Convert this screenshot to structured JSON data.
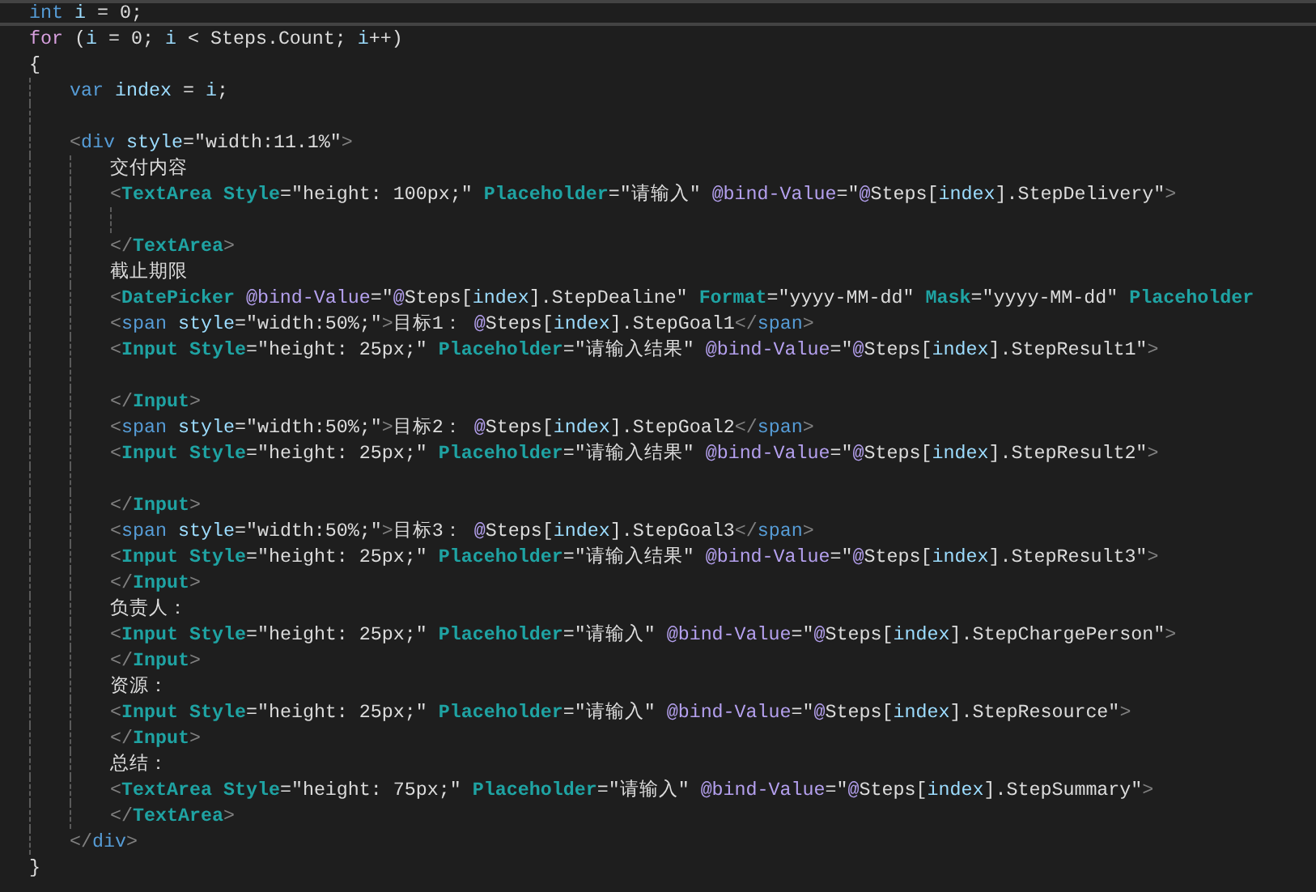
{
  "sticky_line": {
    "kind": "code",
    "tokens": [
      {
        "text": "int",
        "kind": "kw"
      },
      {
        "text": " i",
        "kind": "var"
      },
      {
        "text": " = 0;",
        "kind": "p"
      }
    ]
  },
  "lines": [
    {
      "kind": "code",
      "tokens": [
        {
          "text": "for",
          "kind": "ctl"
        },
        {
          "text": " (",
          "kind": "p"
        },
        {
          "text": "i",
          "kind": "var"
        },
        {
          "text": " = 0; ",
          "kind": "p"
        },
        {
          "text": "i",
          "kind": "var"
        },
        {
          "text": " < Steps.Count; ",
          "kind": "p"
        },
        {
          "text": "i",
          "kind": "var"
        },
        {
          "text": "++)",
          "kind": "p"
        }
      ]
    },
    {
      "kind": "code",
      "tokens": [
        {
          "text": "{",
          "kind": "p"
        }
      ],
      "children": [
        {
          "kind": "code",
          "tokens": [
            {
              "text": "var",
              "kind": "kw"
            },
            {
              "text": " index",
              "kind": "var"
            },
            {
              "text": " = ",
              "kind": "p"
            },
            {
              "text": "i",
              "kind": "var"
            },
            {
              "text": ";",
              "kind": "p"
            }
          ]
        },
        {
          "kind": "blank"
        },
        {
          "kind": "code",
          "tokens": [
            {
              "text": "<",
              "kind": "br"
            },
            {
              "text": "div",
              "kind": "tag"
            },
            {
              "text": " style",
              "kind": "attr"
            },
            {
              "text": "=\"width:11.1%\"",
              "kind": "p"
            },
            {
              "text": ">",
              "kind": "br"
            }
          ],
          "children": [
            {
              "kind": "code",
              "tokens": [
                {
                  "text": "交付内容",
                  "kind": "p"
                }
              ]
            },
            {
              "kind": "code",
              "tokens": [
                {
                  "text": "<",
                  "kind": "br"
                },
                {
                  "text": "TextArea",
                  "kind": "comp"
                },
                {
                  "text": " Style",
                  "kind": "comp"
                },
                {
                  "text": "=\"height: 100px;\" ",
                  "kind": "p"
                },
                {
                  "text": "Placeholder",
                  "kind": "comp"
                },
                {
                  "text": "=\"请输入\" ",
                  "kind": "p"
                },
                {
                  "text": "@bind-Value",
                  "kind": "dir"
                },
                {
                  "text": "=\"",
                  "kind": "p"
                },
                {
                  "text": "@",
                  "kind": "at"
                },
                {
                  "text": "Steps[",
                  "kind": "p"
                },
                {
                  "text": "index",
                  "kind": "var"
                },
                {
                  "text": "].StepDelivery\"",
                  "kind": "p"
                },
                {
                  "text": ">",
                  "kind": "br"
                }
              ],
              "children": [
                {
                  "kind": "blank"
                }
              ]
            },
            {
              "kind": "code",
              "tokens": [
                {
                  "text": "</",
                  "kind": "br"
                },
                {
                  "text": "TextArea",
                  "kind": "comp"
                },
                {
                  "text": ">",
                  "kind": "br"
                }
              ]
            },
            {
              "kind": "code",
              "tokens": [
                {
                  "text": "截止期限",
                  "kind": "p"
                }
              ]
            },
            {
              "kind": "code",
              "tokens": [
                {
                  "text": "<",
                  "kind": "br"
                },
                {
                  "text": "DatePicker",
                  "kind": "comp"
                },
                {
                  "text": " @bind-Value",
                  "kind": "dir"
                },
                {
                  "text": "=\"",
                  "kind": "p"
                },
                {
                  "text": "@",
                  "kind": "at"
                },
                {
                  "text": "Steps[",
                  "kind": "p"
                },
                {
                  "text": "index",
                  "kind": "var"
                },
                {
                  "text": "].StepDealine\" ",
                  "kind": "p"
                },
                {
                  "text": "Format",
                  "kind": "comp"
                },
                {
                  "text": "=\"yyyy-MM-dd\" ",
                  "kind": "p"
                },
                {
                  "text": "Mask",
                  "kind": "comp"
                },
                {
                  "text": "=\"yyyy-MM-dd\" ",
                  "kind": "p"
                },
                {
                  "text": "Placeholder",
                  "kind": "comp"
                }
              ]
            },
            {
              "kind": "code",
              "tokens": [
                {
                  "text": "<",
                  "kind": "br"
                },
                {
                  "text": "span",
                  "kind": "tag"
                },
                {
                  "text": " style",
                  "kind": "attr"
                },
                {
                  "text": "=\"width:50%;\"",
                  "kind": "p"
                },
                {
                  "text": ">",
                  "kind": "br"
                },
                {
                  "text": "目标1： ",
                  "kind": "p"
                },
                {
                  "text": "@",
                  "kind": "at"
                },
                {
                  "text": "Steps[",
                  "kind": "p"
                },
                {
                  "text": "index",
                  "kind": "var"
                },
                {
                  "text": "].StepGoal1",
                  "kind": "p"
                },
                {
                  "text": "</",
                  "kind": "br"
                },
                {
                  "text": "span",
                  "kind": "tag"
                },
                {
                  "text": ">",
                  "kind": "br"
                }
              ]
            },
            {
              "kind": "code",
              "tokens": [
                {
                  "text": "<",
                  "kind": "br"
                },
                {
                  "text": "Input",
                  "kind": "comp"
                },
                {
                  "text": " Style",
                  "kind": "comp"
                },
                {
                  "text": "=\"height: 25px;\" ",
                  "kind": "p"
                },
                {
                  "text": "Placeholder",
                  "kind": "comp"
                },
                {
                  "text": "=\"请输入结果\" ",
                  "kind": "p"
                },
                {
                  "text": "@bind-Value",
                  "kind": "dir"
                },
                {
                  "text": "=\"",
                  "kind": "p"
                },
                {
                  "text": "@",
                  "kind": "at"
                },
                {
                  "text": "Steps[",
                  "kind": "p"
                },
                {
                  "text": "index",
                  "kind": "var"
                },
                {
                  "text": "].StepResult1\"",
                  "kind": "p"
                },
                {
                  "text": ">",
                  "kind": "br"
                }
              ]
            },
            {
              "kind": "blank"
            },
            {
              "kind": "code",
              "tokens": [
                {
                  "text": "</",
                  "kind": "br"
                },
                {
                  "text": "Input",
                  "kind": "comp"
                },
                {
                  "text": ">",
                  "kind": "br"
                }
              ]
            },
            {
              "kind": "code",
              "tokens": [
                {
                  "text": "<",
                  "kind": "br"
                },
                {
                  "text": "span",
                  "kind": "tag"
                },
                {
                  "text": " style",
                  "kind": "attr"
                },
                {
                  "text": "=\"width:50%;\"",
                  "kind": "p"
                },
                {
                  "text": ">",
                  "kind": "br"
                },
                {
                  "text": "目标2： ",
                  "kind": "p"
                },
                {
                  "text": "@",
                  "kind": "at"
                },
                {
                  "text": "Steps[",
                  "kind": "p"
                },
                {
                  "text": "index",
                  "kind": "var"
                },
                {
                  "text": "].StepGoal2",
                  "kind": "p"
                },
                {
                  "text": "</",
                  "kind": "br"
                },
                {
                  "text": "span",
                  "kind": "tag"
                },
                {
                  "text": ">",
                  "kind": "br"
                }
              ]
            },
            {
              "kind": "code",
              "tokens": [
                {
                  "text": "<",
                  "kind": "br"
                },
                {
                  "text": "Input",
                  "kind": "comp"
                },
                {
                  "text": " Style",
                  "kind": "comp"
                },
                {
                  "text": "=\"height: 25px;\" ",
                  "kind": "p"
                },
                {
                  "text": "Placeholder",
                  "kind": "comp"
                },
                {
                  "text": "=\"请输入结果\" ",
                  "kind": "p"
                },
                {
                  "text": "@bind-Value",
                  "kind": "dir"
                },
                {
                  "text": "=\"",
                  "kind": "p"
                },
                {
                  "text": "@",
                  "kind": "at"
                },
                {
                  "text": "Steps[",
                  "kind": "p"
                },
                {
                  "text": "index",
                  "kind": "var"
                },
                {
                  "text": "].StepResult2\"",
                  "kind": "p"
                },
                {
                  "text": ">",
                  "kind": "br"
                }
              ]
            },
            {
              "kind": "blank"
            },
            {
              "kind": "code",
              "tokens": [
                {
                  "text": "</",
                  "kind": "br"
                },
                {
                  "text": "Input",
                  "kind": "comp"
                },
                {
                  "text": ">",
                  "kind": "br"
                }
              ]
            },
            {
              "kind": "code",
              "tokens": [
                {
                  "text": "<",
                  "kind": "br"
                },
                {
                  "text": "span",
                  "kind": "tag"
                },
                {
                  "text": " style",
                  "kind": "attr"
                },
                {
                  "text": "=\"width:50%;\"",
                  "kind": "p"
                },
                {
                  "text": ">",
                  "kind": "br"
                },
                {
                  "text": "目标3： ",
                  "kind": "p"
                },
                {
                  "text": "@",
                  "kind": "at"
                },
                {
                  "text": "Steps[",
                  "kind": "p"
                },
                {
                  "text": "index",
                  "kind": "var"
                },
                {
                  "text": "].StepGoal3",
                  "kind": "p"
                },
                {
                  "text": "</",
                  "kind": "br"
                },
                {
                  "text": "span",
                  "kind": "tag"
                },
                {
                  "text": ">",
                  "kind": "br"
                }
              ]
            },
            {
              "kind": "code",
              "tokens": [
                {
                  "text": "<",
                  "kind": "br"
                },
                {
                  "text": "Input",
                  "kind": "comp"
                },
                {
                  "text": " Style",
                  "kind": "comp"
                },
                {
                  "text": "=\"height: 25px;\" ",
                  "kind": "p"
                },
                {
                  "text": "Placeholder",
                  "kind": "comp"
                },
                {
                  "text": "=\"请输入结果\" ",
                  "kind": "p"
                },
                {
                  "text": "@bind-Value",
                  "kind": "dir"
                },
                {
                  "text": "=\"",
                  "kind": "p"
                },
                {
                  "text": "@",
                  "kind": "at"
                },
                {
                  "text": "Steps[",
                  "kind": "p"
                },
                {
                  "text": "index",
                  "kind": "var"
                },
                {
                  "text": "].StepResult3\"",
                  "kind": "p"
                },
                {
                  "text": ">",
                  "kind": "br"
                }
              ]
            },
            {
              "kind": "code",
              "tokens": [
                {
                  "text": "</",
                  "kind": "br"
                },
                {
                  "text": "Input",
                  "kind": "comp"
                },
                {
                  "text": ">",
                  "kind": "br"
                }
              ]
            },
            {
              "kind": "code",
              "tokens": [
                {
                  "text": "负责人：",
                  "kind": "p"
                }
              ]
            },
            {
              "kind": "code",
              "tokens": [
                {
                  "text": "<",
                  "kind": "br"
                },
                {
                  "text": "Input",
                  "kind": "comp"
                },
                {
                  "text": " Style",
                  "kind": "comp"
                },
                {
                  "text": "=\"height: 25px;\" ",
                  "kind": "p"
                },
                {
                  "text": "Placeholder",
                  "kind": "comp"
                },
                {
                  "text": "=\"请输入\" ",
                  "kind": "p"
                },
                {
                  "text": "@bind-Value",
                  "kind": "dir"
                },
                {
                  "text": "=\"",
                  "kind": "p"
                },
                {
                  "text": "@",
                  "kind": "at"
                },
                {
                  "text": "Steps[",
                  "kind": "p"
                },
                {
                  "text": "index",
                  "kind": "var"
                },
                {
                  "text": "].StepChargePerson\"",
                  "kind": "p"
                },
                {
                  "text": ">",
                  "kind": "br"
                }
              ]
            },
            {
              "kind": "code",
              "tokens": [
                {
                  "text": "</",
                  "kind": "br"
                },
                {
                  "text": "Input",
                  "kind": "comp"
                },
                {
                  "text": ">",
                  "kind": "br"
                }
              ]
            },
            {
              "kind": "code",
              "tokens": [
                {
                  "text": "资源：",
                  "kind": "p"
                }
              ]
            },
            {
              "kind": "code",
              "tokens": [
                {
                  "text": "<",
                  "kind": "br"
                },
                {
                  "text": "Input",
                  "kind": "comp"
                },
                {
                  "text": " Style",
                  "kind": "comp"
                },
                {
                  "text": "=\"height: 25px;\" ",
                  "kind": "p"
                },
                {
                  "text": "Placeholder",
                  "kind": "comp"
                },
                {
                  "text": "=\"请输入\" ",
                  "kind": "p"
                },
                {
                  "text": "@bind-Value",
                  "kind": "dir"
                },
                {
                  "text": "=\"",
                  "kind": "p"
                },
                {
                  "text": "@",
                  "kind": "at"
                },
                {
                  "text": "Steps[",
                  "kind": "p"
                },
                {
                  "text": "index",
                  "kind": "var"
                },
                {
                  "text": "].StepResource\"",
                  "kind": "p"
                },
                {
                  "text": ">",
                  "kind": "br"
                }
              ]
            },
            {
              "kind": "code",
              "tokens": [
                {
                  "text": "</",
                  "kind": "br"
                },
                {
                  "text": "Input",
                  "kind": "comp"
                },
                {
                  "text": ">",
                  "kind": "br"
                }
              ]
            },
            {
              "kind": "code",
              "tokens": [
                {
                  "text": "总结：",
                  "kind": "p"
                }
              ]
            },
            {
              "kind": "code",
              "tokens": [
                {
                  "text": "<",
                  "kind": "br"
                },
                {
                  "text": "TextArea",
                  "kind": "comp"
                },
                {
                  "text": " Style",
                  "kind": "comp"
                },
                {
                  "text": "=\"height: 75px;\" ",
                  "kind": "p"
                },
                {
                  "text": "Placeholder",
                  "kind": "comp"
                },
                {
                  "text": "=\"请输入\" ",
                  "kind": "p"
                },
                {
                  "text": "@bind-Value",
                  "kind": "dir"
                },
                {
                  "text": "=\"",
                  "kind": "p"
                },
                {
                  "text": "@",
                  "kind": "at"
                },
                {
                  "text": "Steps[",
                  "kind": "p"
                },
                {
                  "text": "index",
                  "kind": "var"
                },
                {
                  "text": "].StepSummary\"",
                  "kind": "p"
                },
                {
                  "text": ">",
                  "kind": "br"
                }
              ]
            },
            {
              "kind": "code",
              "tokens": [
                {
                  "text": "</",
                  "kind": "br"
                },
                {
                  "text": "TextArea",
                  "kind": "comp"
                },
                {
                  "text": ">",
                  "kind": "br"
                }
              ]
            }
          ]
        },
        {
          "kind": "code",
          "tokens": [
            {
              "text": "</",
              "kind": "br"
            },
            {
              "text": "div",
              "kind": "tag"
            },
            {
              "text": ">",
              "kind": "br"
            }
          ]
        }
      ]
    },
    {
      "kind": "code",
      "tokens": [
        {
          "text": "}",
          "kind": "p"
        }
      ]
    }
  ]
}
